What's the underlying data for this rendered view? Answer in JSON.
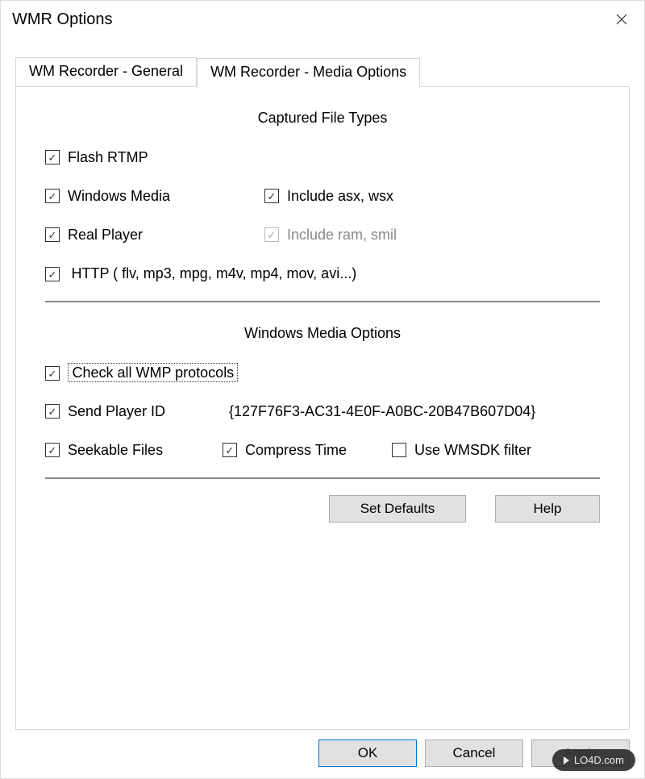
{
  "titlebar": {
    "title": "WMR Options"
  },
  "tabs": {
    "general": "WM Recorder - General",
    "media": "WM Recorder - Media Options"
  },
  "section1": {
    "title": "Captured File Types",
    "flash": "Flash RTMP",
    "wmedia": "Windows Media",
    "include_asx": "Include asx, wsx",
    "real": "Real Player",
    "include_ram": "Include ram, smil",
    "http": "HTTP ( flv, mp3, mpg, m4v, mp4, mov, avi...)"
  },
  "section2": {
    "title": "Windows Media Options",
    "check_all": "Check all WMP protocols",
    "send_player_id": "Send Player ID",
    "player_id_value": "{127F76F3-AC31-4E0F-A0BC-20B47B607D04}",
    "seekable": "Seekable Files",
    "compress": "Compress Time",
    "wmsdk": "Use WMSDK filter"
  },
  "buttons": {
    "set_defaults": "Set Defaults",
    "help": "Help",
    "ok": "OK",
    "cancel": "Cancel",
    "apply": "Apply"
  },
  "watermark": "LO4D.com"
}
